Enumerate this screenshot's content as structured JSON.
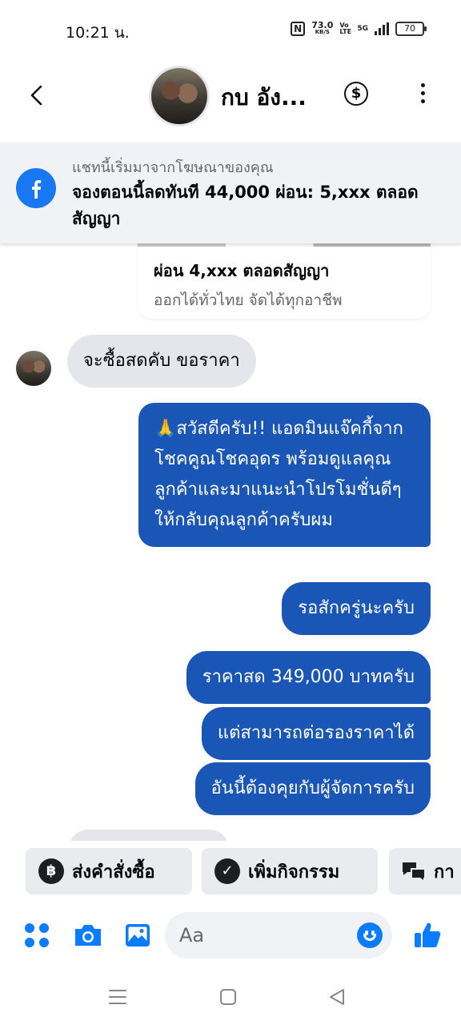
{
  "status_bar": {
    "time": "10:21 น.",
    "net_speed": "73.0",
    "net_unit": "KB/S",
    "volte": "Vo LTE",
    "network": "5G",
    "battery": "70"
  },
  "header": {
    "contact_name": "กบ อัง..."
  },
  "ad_banner": {
    "source_text": "แชทนี้เริ่มมาจากโฆษณาของคุณ",
    "headline": "จองตอนนี้ลดทันที 44,000 ผ่อน:  5,xxx ตลอดสัญญา"
  },
  "ad_card": {
    "title": "ผ่อน 4,xxx ตลอดสัญญา",
    "subtitle": "ออกได้ทั่วไทย จัดได้ทุกอาชีพ"
  },
  "messages": {
    "incoming_1": "จะซื้อสดคับ ขอราคา",
    "outgoing_1": "🙏สวัสดีครับ!! แอดมินแจ๊คกี้จากโชคคูณโชคอุดร พร้อมดูแลคุณลูกค้าและมาแนะนำโปรโมชั่นดีๆ ให้กลับคุณลูกค้าครับผม",
    "outgoing_2": "รอสักครู่นะครับ",
    "outgoing_3": "ราคาสด 349,000 บาทครับ",
    "outgoing_4": "แต่สามารถต่อรองราคาได้",
    "outgoing_5": "อันนี้ต้องคุยกับผู้จัดการครับ"
  },
  "quick_actions": {
    "send_order": "ส่งคำสั่งซื้อ",
    "add_activity": "เพิ่มกิจกรรม",
    "third": "กา"
  },
  "composer": {
    "placeholder": "Aa"
  },
  "colors": {
    "outgoing_bubble": "#1a56b5",
    "incoming_bubble": "#e4e6eb",
    "accent": "#0a7cff",
    "facebook_blue": "#1877f2"
  }
}
